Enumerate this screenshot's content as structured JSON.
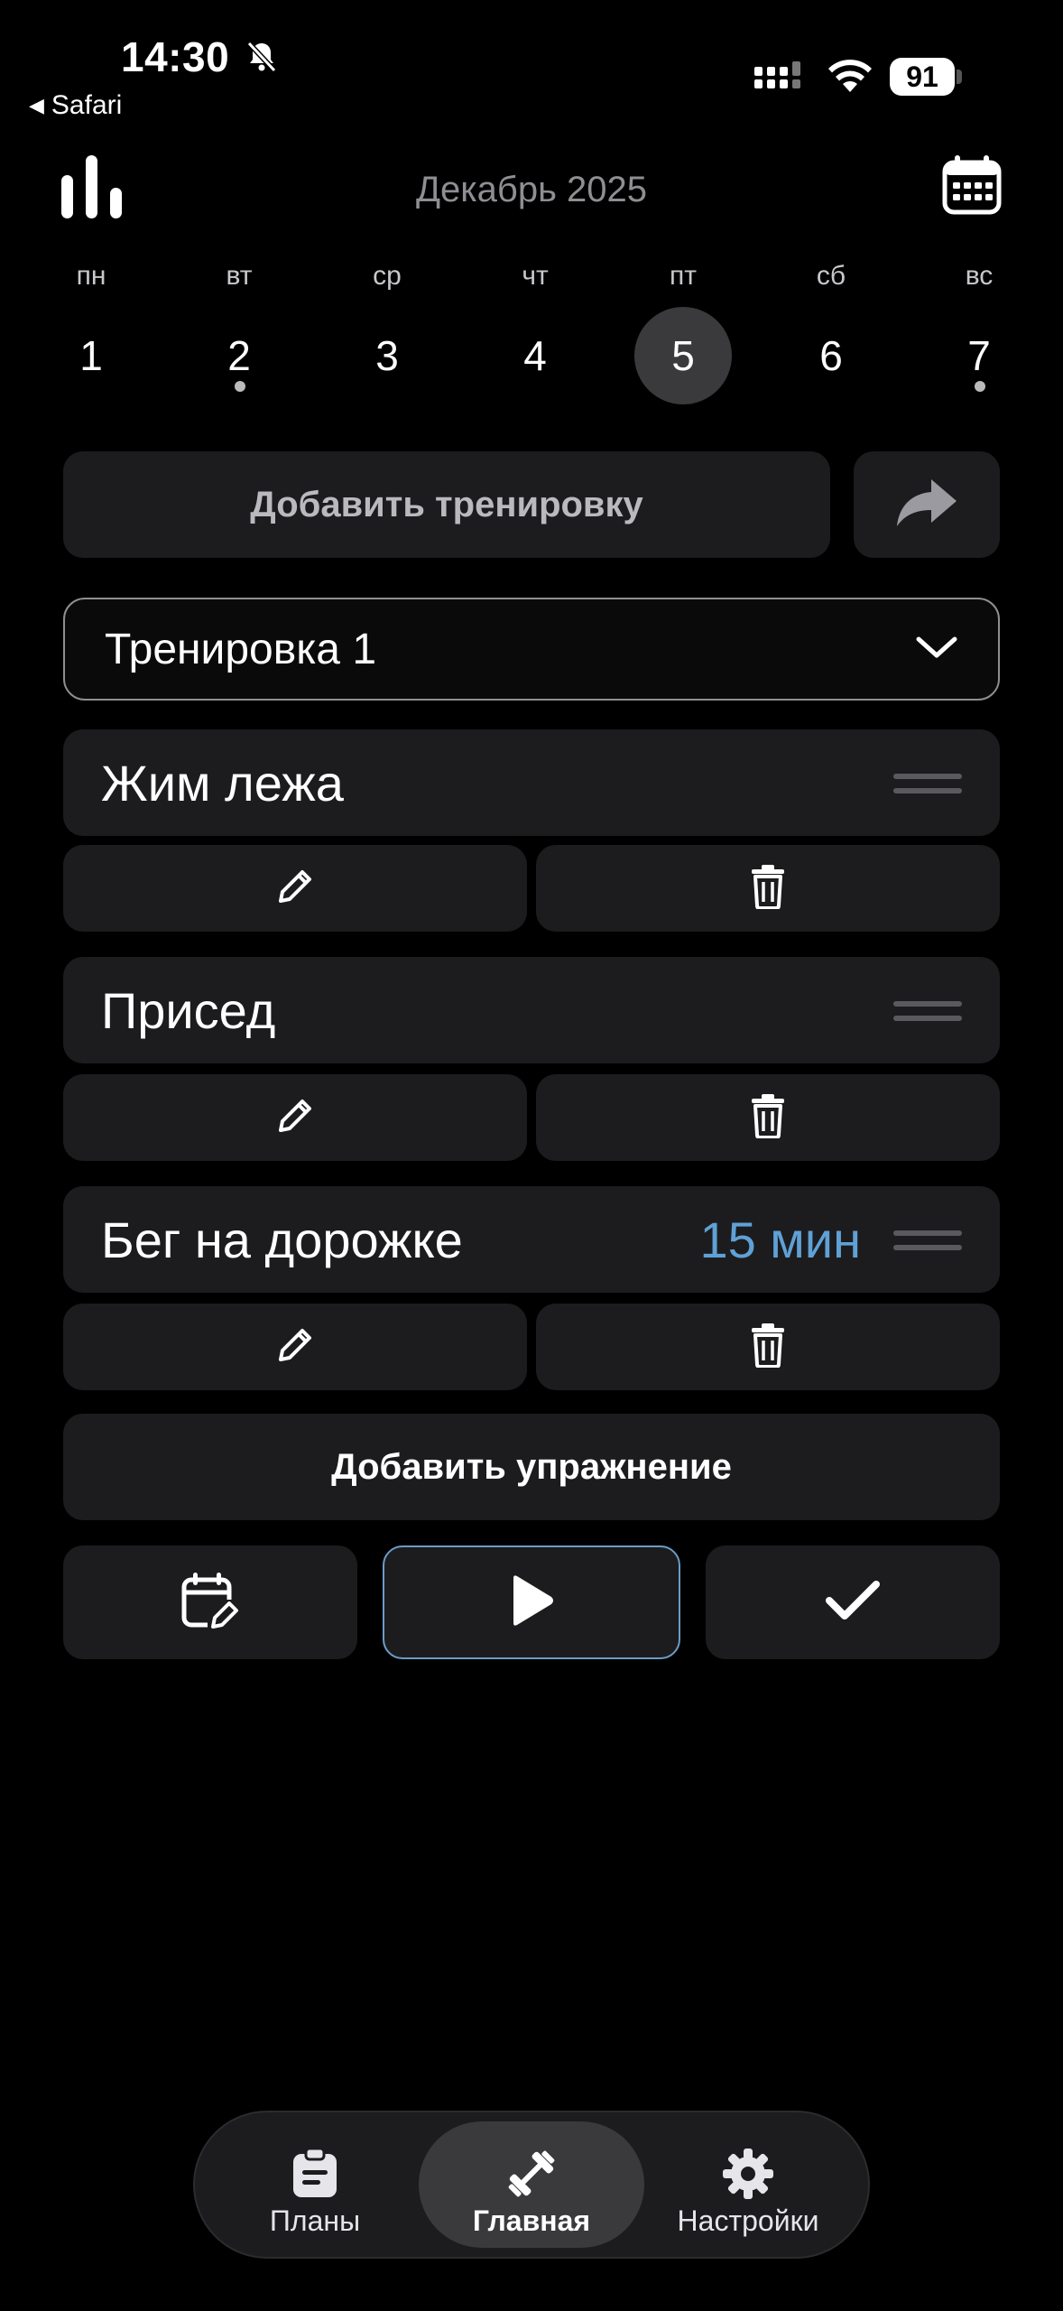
{
  "status_bar": {
    "time": "14:30",
    "back_app": "Safari",
    "battery": "91"
  },
  "header": {
    "month_title": "Декабрь 2025"
  },
  "week": {
    "days": [
      {
        "name": "пн",
        "num": "1",
        "selected": false,
        "dot": false
      },
      {
        "name": "вт",
        "num": "2",
        "selected": false,
        "dot": true
      },
      {
        "name": "ср",
        "num": "3",
        "selected": false,
        "dot": false
      },
      {
        "name": "чт",
        "num": "4",
        "selected": false,
        "dot": false
      },
      {
        "name": "пт",
        "num": "5",
        "selected": true,
        "dot": false
      },
      {
        "name": "сб",
        "num": "6",
        "selected": false,
        "dot": false
      },
      {
        "name": "вс",
        "num": "7",
        "selected": false,
        "dot": true
      }
    ]
  },
  "actions": {
    "add_workout": "Добавить тренировку",
    "add_exercise": "Добавить упражнение"
  },
  "workout_select": {
    "value": "Тренировка 1"
  },
  "exercises": [
    {
      "name": "Жим лежа",
      "duration": ""
    },
    {
      "name": "Присед",
      "duration": ""
    },
    {
      "name": "Бег на дорожке",
      "duration": "15 мин"
    }
  ],
  "tabs": [
    {
      "label": "Планы",
      "icon": "clipboard-icon",
      "active": false
    },
    {
      "label": "Главная",
      "icon": "dumbbell-icon",
      "active": true
    },
    {
      "label": "Настройки",
      "icon": "gear-icon",
      "active": false
    }
  ],
  "colors": {
    "accent_blue": "#5fa1d6",
    "card_bg": "#1c1c1e",
    "selected_day_bg": "#3a3a3c"
  }
}
